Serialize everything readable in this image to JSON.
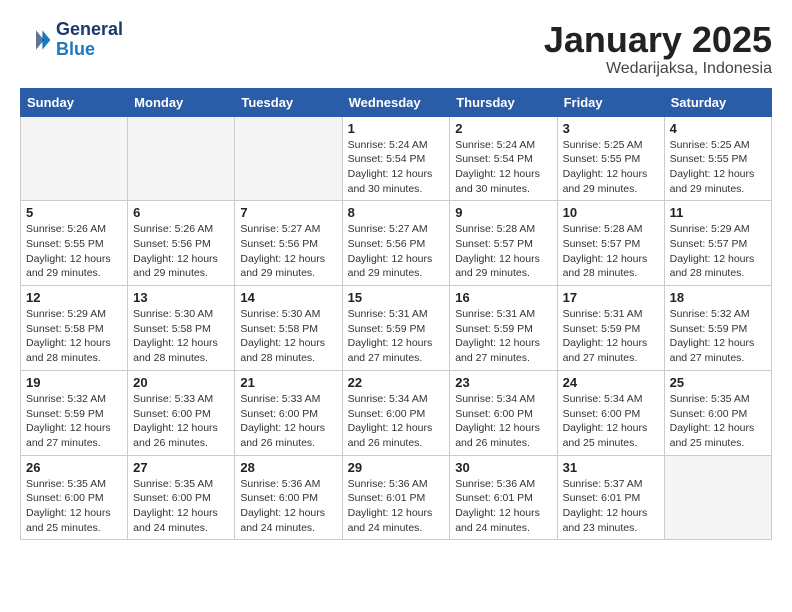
{
  "logo": {
    "line1": "General",
    "line2": "Blue"
  },
  "title": "January 2025",
  "subtitle": "Wedarijaksa, Indonesia",
  "weekdays": [
    "Sunday",
    "Monday",
    "Tuesday",
    "Wednesday",
    "Thursday",
    "Friday",
    "Saturday"
  ],
  "weeks": [
    [
      {
        "day": "",
        "info": ""
      },
      {
        "day": "",
        "info": ""
      },
      {
        "day": "",
        "info": ""
      },
      {
        "day": "1",
        "info": "Sunrise: 5:24 AM\nSunset: 5:54 PM\nDaylight: 12 hours\nand 30 minutes."
      },
      {
        "day": "2",
        "info": "Sunrise: 5:24 AM\nSunset: 5:54 PM\nDaylight: 12 hours\nand 30 minutes."
      },
      {
        "day": "3",
        "info": "Sunrise: 5:25 AM\nSunset: 5:55 PM\nDaylight: 12 hours\nand 29 minutes."
      },
      {
        "day": "4",
        "info": "Sunrise: 5:25 AM\nSunset: 5:55 PM\nDaylight: 12 hours\nand 29 minutes."
      }
    ],
    [
      {
        "day": "5",
        "info": "Sunrise: 5:26 AM\nSunset: 5:55 PM\nDaylight: 12 hours\nand 29 minutes."
      },
      {
        "day": "6",
        "info": "Sunrise: 5:26 AM\nSunset: 5:56 PM\nDaylight: 12 hours\nand 29 minutes."
      },
      {
        "day": "7",
        "info": "Sunrise: 5:27 AM\nSunset: 5:56 PM\nDaylight: 12 hours\nand 29 minutes."
      },
      {
        "day": "8",
        "info": "Sunrise: 5:27 AM\nSunset: 5:56 PM\nDaylight: 12 hours\nand 29 minutes."
      },
      {
        "day": "9",
        "info": "Sunrise: 5:28 AM\nSunset: 5:57 PM\nDaylight: 12 hours\nand 29 minutes."
      },
      {
        "day": "10",
        "info": "Sunrise: 5:28 AM\nSunset: 5:57 PM\nDaylight: 12 hours\nand 28 minutes."
      },
      {
        "day": "11",
        "info": "Sunrise: 5:29 AM\nSunset: 5:57 PM\nDaylight: 12 hours\nand 28 minutes."
      }
    ],
    [
      {
        "day": "12",
        "info": "Sunrise: 5:29 AM\nSunset: 5:58 PM\nDaylight: 12 hours\nand 28 minutes."
      },
      {
        "day": "13",
        "info": "Sunrise: 5:30 AM\nSunset: 5:58 PM\nDaylight: 12 hours\nand 28 minutes."
      },
      {
        "day": "14",
        "info": "Sunrise: 5:30 AM\nSunset: 5:58 PM\nDaylight: 12 hours\nand 28 minutes."
      },
      {
        "day": "15",
        "info": "Sunrise: 5:31 AM\nSunset: 5:59 PM\nDaylight: 12 hours\nand 27 minutes."
      },
      {
        "day": "16",
        "info": "Sunrise: 5:31 AM\nSunset: 5:59 PM\nDaylight: 12 hours\nand 27 minutes."
      },
      {
        "day": "17",
        "info": "Sunrise: 5:31 AM\nSunset: 5:59 PM\nDaylight: 12 hours\nand 27 minutes."
      },
      {
        "day": "18",
        "info": "Sunrise: 5:32 AM\nSunset: 5:59 PM\nDaylight: 12 hours\nand 27 minutes."
      }
    ],
    [
      {
        "day": "19",
        "info": "Sunrise: 5:32 AM\nSunset: 5:59 PM\nDaylight: 12 hours\nand 27 minutes."
      },
      {
        "day": "20",
        "info": "Sunrise: 5:33 AM\nSunset: 6:00 PM\nDaylight: 12 hours\nand 26 minutes."
      },
      {
        "day": "21",
        "info": "Sunrise: 5:33 AM\nSunset: 6:00 PM\nDaylight: 12 hours\nand 26 minutes."
      },
      {
        "day": "22",
        "info": "Sunrise: 5:34 AM\nSunset: 6:00 PM\nDaylight: 12 hours\nand 26 minutes."
      },
      {
        "day": "23",
        "info": "Sunrise: 5:34 AM\nSunset: 6:00 PM\nDaylight: 12 hours\nand 26 minutes."
      },
      {
        "day": "24",
        "info": "Sunrise: 5:34 AM\nSunset: 6:00 PM\nDaylight: 12 hours\nand 25 minutes."
      },
      {
        "day": "25",
        "info": "Sunrise: 5:35 AM\nSunset: 6:00 PM\nDaylight: 12 hours\nand 25 minutes."
      }
    ],
    [
      {
        "day": "26",
        "info": "Sunrise: 5:35 AM\nSunset: 6:00 PM\nDaylight: 12 hours\nand 25 minutes."
      },
      {
        "day": "27",
        "info": "Sunrise: 5:35 AM\nSunset: 6:00 PM\nDaylight: 12 hours\nand 24 minutes."
      },
      {
        "day": "28",
        "info": "Sunrise: 5:36 AM\nSunset: 6:00 PM\nDaylight: 12 hours\nand 24 minutes."
      },
      {
        "day": "29",
        "info": "Sunrise: 5:36 AM\nSunset: 6:01 PM\nDaylight: 12 hours\nand 24 minutes."
      },
      {
        "day": "30",
        "info": "Sunrise: 5:36 AM\nSunset: 6:01 PM\nDaylight: 12 hours\nand 24 minutes."
      },
      {
        "day": "31",
        "info": "Sunrise: 5:37 AM\nSunset: 6:01 PM\nDaylight: 12 hours\nand 23 minutes."
      },
      {
        "day": "",
        "info": ""
      }
    ]
  ]
}
